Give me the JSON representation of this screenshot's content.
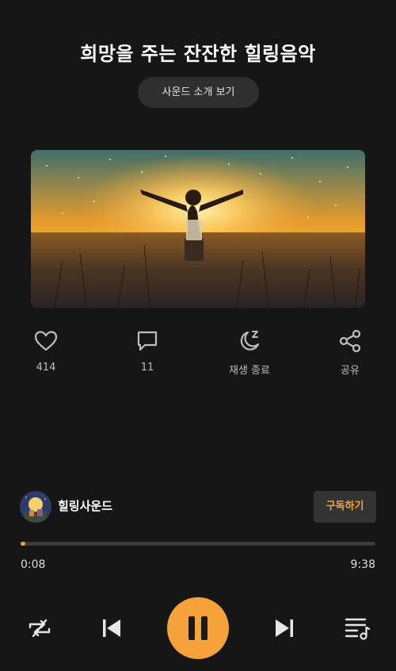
{
  "header": {
    "title": "희망을 주는 잔잔한 힐링음악",
    "intro_button_label": "사운드 소개 보기"
  },
  "actions": {
    "like_count": "414",
    "comment_count": "11",
    "sleep_label": "재생 종료",
    "share_label": "공유"
  },
  "channel": {
    "name": "힐링사운드",
    "subscribe_label": "구독하기"
  },
  "player": {
    "elapsed": "0:08",
    "total": "9:38",
    "progress_fraction": 0.014
  },
  "icons": {
    "like": "heart-icon",
    "comment": "speech-bubble-icon",
    "sleep": "moon-z-icon",
    "share": "share-icon",
    "repeat": "repeat-icon",
    "previous": "skip-previous-icon",
    "pause": "pause-icon",
    "next": "skip-next-icon",
    "playlist": "playlist-icon"
  },
  "colors": {
    "accent": "#f6a23b",
    "background": "#161616"
  }
}
